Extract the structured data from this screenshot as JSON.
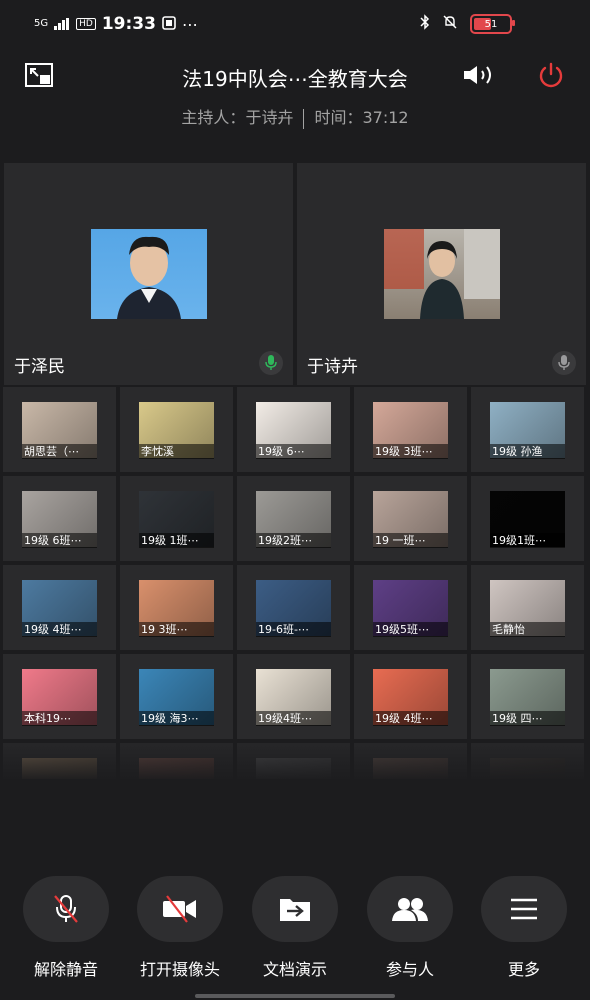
{
  "status_bar": {
    "signal": "5G",
    "hd": "HD",
    "time": "19:33",
    "extra": "⋯",
    "battery_level": "51",
    "colors": {
      "battery": "#e2474c"
    }
  },
  "header": {
    "title": "法19中队会⋯全教育大会",
    "host_label": "主持人：",
    "host_name": "于诗卉",
    "time_label": "时间：",
    "time_value": "37:12"
  },
  "speakers": [
    {
      "name": "于泽民",
      "mic_state": "speaking",
      "mic_color": "#2fb85b"
    },
    {
      "name": "于诗卉",
      "mic_state": "idle",
      "mic_color": "#9a9a9c"
    }
  ],
  "participants": [
    {
      "label": "胡思芸（⋯",
      "thumb": "#c9b8a8"
    },
    {
      "label": "李忱溪",
      "thumb": "#d9c98a"
    },
    {
      "label": "19级 6⋯",
      "thumb": "#f2ece6"
    },
    {
      "label": "19级 3班⋯",
      "thumb": "#d4a899"
    },
    {
      "label": "19级 孙渔",
      "thumb": "#8fb0c4"
    },
    {
      "label": "19级 6班⋯",
      "thumb": "#a9a4a0"
    },
    {
      "label": "19级 1班⋯",
      "thumb": "#2f3338"
    },
    {
      "label": "19级2班⋯",
      "thumb": "#9c9a96"
    },
    {
      "label": "19 一班⋯",
      "thumb": "#b8a49a"
    },
    {
      "label": "19级1班⋯",
      "thumb": "#050505"
    },
    {
      "label": "19级 4班⋯",
      "thumb": "#4d7aa0"
    },
    {
      "label": "19 3班⋯",
      "thumb": "#d9906c"
    },
    {
      "label": "19-6班-⋯",
      "thumb": "#3c5d85"
    },
    {
      "label": "19级5班⋯",
      "thumb": "#5e3f86"
    },
    {
      "label": "毛静怡",
      "thumb": "#cfc5c1"
    },
    {
      "label": "本科19⋯",
      "thumb": "#f07a8a"
    },
    {
      "label": "19级 海3⋯",
      "thumb": "#3b86b8"
    },
    {
      "label": "19级4班⋯",
      "thumb": "#e9e1d4"
    },
    {
      "label": "19级 4班⋯",
      "thumb": "#e86c52"
    },
    {
      "label": "19级 四⋯",
      "thumb": "#8b9a8f"
    },
    {
      "label": "",
      "thumb": "#7d6a55"
    },
    {
      "label": "",
      "thumb": "#6a4b45"
    },
    {
      "label": "",
      "thumb": "#4e4e50"
    },
    {
      "label": "",
      "thumb": "#5a4b46"
    },
    {
      "label": "",
      "thumb": "#3a3634"
    }
  ],
  "controls": [
    {
      "label": "解除静音",
      "icon": "mic-muted-icon"
    },
    {
      "label": "打开摄像头",
      "icon": "camera-off-icon"
    },
    {
      "label": "文档演示",
      "icon": "share-document-icon"
    },
    {
      "label": "参与人",
      "icon": "participants-icon"
    },
    {
      "label": "更多",
      "icon": "menu-icon"
    }
  ]
}
